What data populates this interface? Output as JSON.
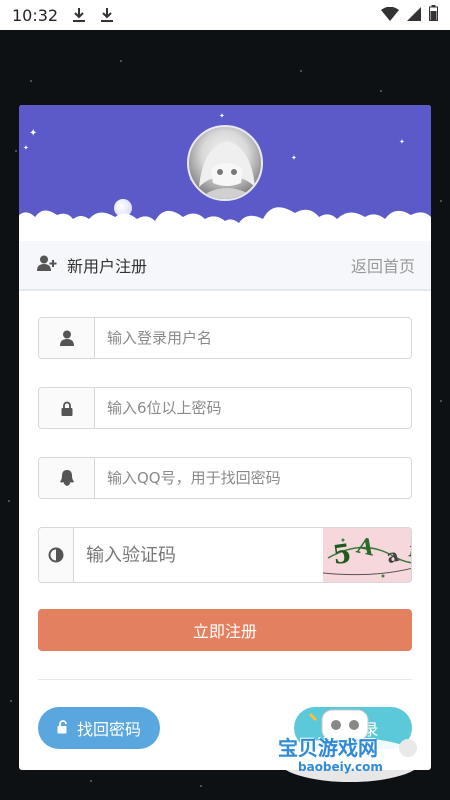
{
  "status_bar": {
    "time": "10:32"
  },
  "header": {
    "title": "新用户注册",
    "back_link": "返回首页"
  },
  "form": {
    "username_placeholder": "输入登录用户名",
    "password_placeholder": "输入6位以上密码",
    "qq_placeholder": "输入QQ号，用于找回密码",
    "captcha_placeholder": "输入验证码",
    "captcha_text": "5AarH",
    "submit_label": "立即注册"
  },
  "footer": {
    "find_password_label": "找回密码",
    "login_label": "登录"
  },
  "watermark": {
    "text": "宝贝游戏网",
    "url": "baobeiy.com"
  },
  "icons": {
    "status": [
      "download-icon",
      "download-icon",
      "wifi-icon",
      "signal-icon",
      "battery-icon"
    ],
    "header": "add-user-icon",
    "fields": [
      "user-icon",
      "lock-icon",
      "qq-icon",
      "contrast-icon"
    ],
    "find_password": "unlock-icon",
    "login": "user-icon"
  },
  "colors": {
    "banner": "#5b5ac8",
    "submit": "#e3805f",
    "find_password_button": "#5aa7e0",
    "login_button": "#5bc9d9"
  }
}
